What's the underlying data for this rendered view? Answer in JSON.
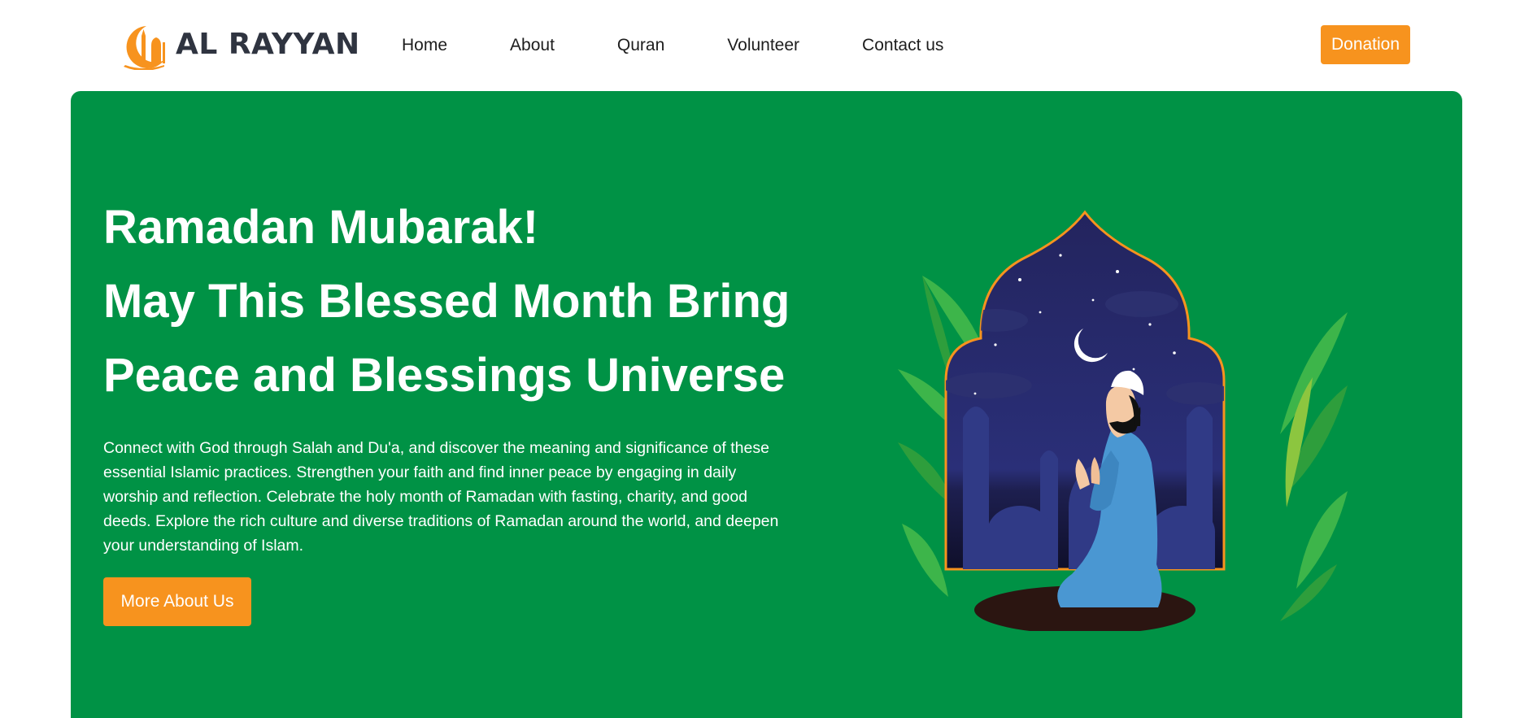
{
  "brand": {
    "name": "AL RAYYAN",
    "accent_color": "#f7931e",
    "primary_color": "#009245"
  },
  "nav": {
    "items": [
      {
        "label": "Home"
      },
      {
        "label": "About"
      },
      {
        "label": "Quran"
      },
      {
        "label": "Volunteer"
      },
      {
        "label": "Contact us"
      }
    ],
    "donate_label": "Donation"
  },
  "hero": {
    "heading_lines": [
      "Ramadan Mubarak!",
      "May This Blessed Month Bring",
      "Peace and Blessings Universe"
    ],
    "paragraph": "Connect with God through Salah and Du'a, and discover the meaning and significance of these essential Islamic practices. Strengthen your faith and find inner peace by engaging in daily worship and reflection. Celebrate the holy month of Ramadan with fasting, charity, and good deeds. Explore the rich culture and diverse traditions of Ramadan around the world, and deepen your understanding of Islam.",
    "cta_label": "More About Us",
    "illustration": "man-praying-in-mosque-window-icon"
  }
}
